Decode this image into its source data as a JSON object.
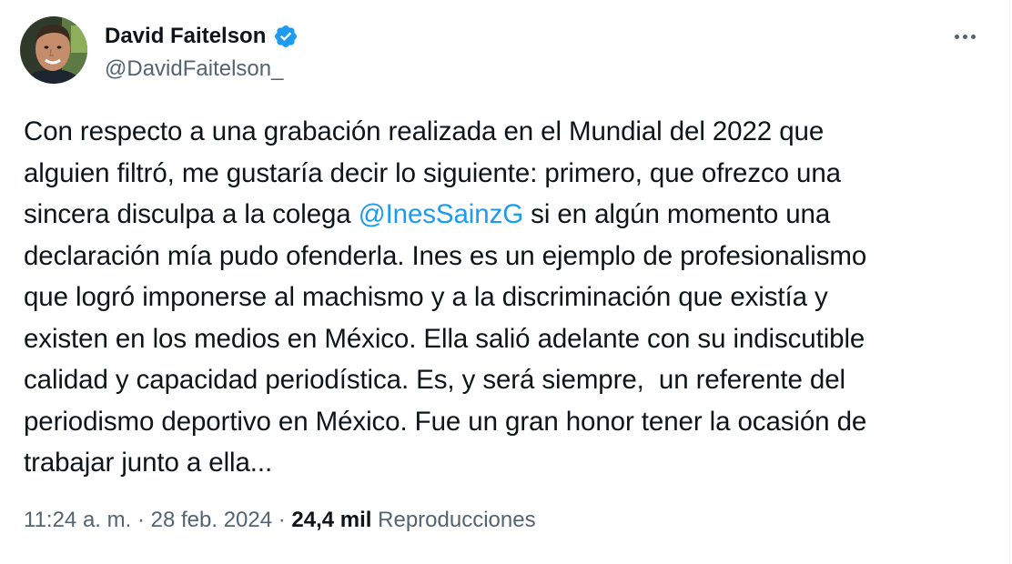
{
  "author": {
    "display_name": "David Faitelson",
    "handle": "@DavidFaitelson_",
    "verified": true,
    "verified_color": "#1d9bf0"
  },
  "tweet": {
    "lines": [
      {
        "before": "Con respecto a una grabación realizada en el Mundial del 2022 que"
      },
      {
        "before": "alguien filtró, me gustaría decir lo siguiente: primero, que ofrezco una"
      },
      {
        "before": "sincera disculpa a la colega ",
        "mention": "@InesSainzG",
        "after": " si en algún momento una"
      },
      {
        "before": "declaración mía pudo ofenderla. Ines es un ejemplo de profesionalismo"
      },
      {
        "before": "que logró imponerse al machismo y a la discriminación que existía y"
      },
      {
        "before": "existen en los medios en México. Ella salió adelante con su indiscutible"
      },
      {
        "before": "calidad y capacidad periodística. Es, y será siempre,  un referente del"
      },
      {
        "before": "periodismo deportivo en México. Fue un gran honor tener la ocasión de"
      },
      {
        "before": "trabajar junto a ella..."
      }
    ],
    "mention_color": "#1d9bf0"
  },
  "meta": {
    "time": "11:24 a. m.",
    "separator": " · ",
    "date": "28 feb. 2024",
    "views_count": "24,4 mil",
    "views_label": "Reproducciones"
  }
}
